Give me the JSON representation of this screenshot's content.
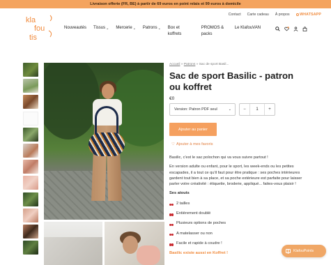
{
  "announcement": "Livraison offerte (FR, BE) à partir de 69 euros en point relais et 99 euros à domicile",
  "logo": {
    "line1": "kla",
    "line2": "fou",
    "line3": "tis"
  },
  "top_links": [
    "Contact",
    "Carte cadeau",
    "À propos"
  ],
  "whatsapp": "WHATSAPP",
  "nav": [
    {
      "label": "Nouveautés",
      "chevron": false
    },
    {
      "label": "Tissus",
      "chevron": true
    },
    {
      "label": "Mercerie",
      "chevron": true
    },
    {
      "label": "Patrons",
      "chevron": true
    },
    {
      "label": "Box et koffrets",
      "chevron": false
    },
    {
      "label": "PROMOS & packs",
      "chevron": false
    },
    {
      "label": "Le KlafouVAN",
      "chevron": false
    }
  ],
  "icons": [
    "search-icon",
    "wishlist-icon",
    "user-icon",
    "cart-icon"
  ],
  "breadcrumb": {
    "home": "Accueil",
    "sep": "»",
    "cat": "Patrons",
    "current": "Sac de sport Basil..."
  },
  "product": {
    "title": "Sac de sport Basilic - patron ou koffret",
    "price": "€0",
    "variant": "Version: Patron PDF seul",
    "qty_minus": "−",
    "qty": "1",
    "qty_plus": "+",
    "add_to_cart": "Ajouter au panier",
    "favorite": "Ajouter à mes favoris"
  },
  "description": {
    "intro": "Basilic, c'est le sac polochon qui va vous suivre partout !",
    "body": "En version adulte ou enfant, pour le sport, les week-ends ou les petites escapades, il a tout ce qu'il faut pour être pratique : ses poches intérieures gardent tout bien à sa place, et sa poche extérieure est parfaite pour laisser parler votre créativité : étiquette, broderie, appliqué... faites-vous plaisir !",
    "heading": "Ses atouts",
    "features": [
      "2 tailles",
      "Entièrement doublé",
      "Plusieurs options de poches",
      "A matelasser ou non",
      "Facile et rapide à coudre !"
    ],
    "link": "Basilic existe aussi en Koffret !"
  },
  "points_button": "KlafouPoints",
  "colors": {
    "accent": "#f5a05f",
    "announce": "#f4a45f",
    "link": "#f08a3c"
  }
}
